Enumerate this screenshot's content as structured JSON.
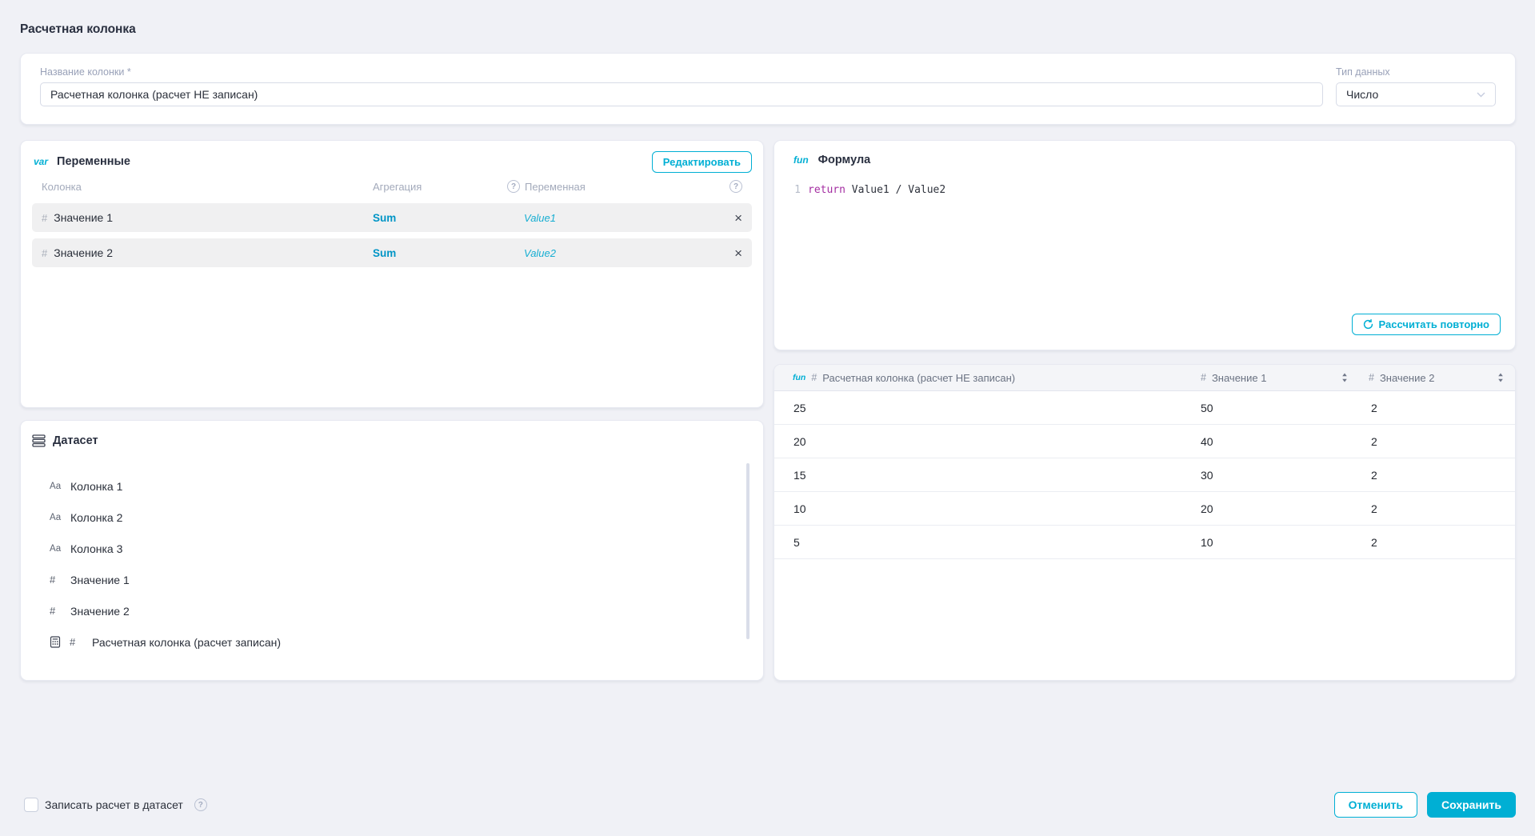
{
  "page": {
    "title": "Расчетная колонка"
  },
  "colors": {
    "accent": "#00afd4",
    "sum_accent": "#0095c6",
    "keyword": "#a42ea2",
    "background": "#f0f1f6"
  },
  "icons": {
    "help": "?",
    "close": "×",
    "text_type": "Аа",
    "number_type": "#"
  },
  "name_field": {
    "label": "Название колонки *",
    "value": "Расчетная колонка (расчет НЕ записан)"
  },
  "type_field": {
    "label": "Тип данных",
    "value": "Число"
  },
  "variables": {
    "tag": "var",
    "title": "Переменные",
    "edit_button": "Редактировать",
    "columns": {
      "column": "Колонка",
      "aggregation": "Агрегация",
      "variable": "Переменная"
    },
    "rows": [
      {
        "type_icon": "#",
        "column": "Значение 1",
        "aggregation": "Sum",
        "variable": "Value1"
      },
      {
        "type_icon": "#",
        "column": "Значение 2",
        "aggregation": "Sum",
        "variable": "Value2"
      }
    ]
  },
  "dataset": {
    "title": "Датасет",
    "items": [
      {
        "icon": "Аа",
        "label": "Колонка 1"
      },
      {
        "icon": "Аа",
        "label": "Колонка 2"
      },
      {
        "icon": "Аа",
        "label": "Колонка 3"
      },
      {
        "icon": "#",
        "label": "Значение 1"
      },
      {
        "icon": "#",
        "label": "Значение 2"
      },
      {
        "icon": "calculator",
        "hash": "#",
        "label": "Расчетная колонка (расчет записан)"
      }
    ]
  },
  "formula": {
    "tag": "fun",
    "title": "Формула",
    "line_number": "1",
    "keyword": "return",
    "expression": "Value1 / Value2",
    "recalc_button": "Рассчитать повторно"
  },
  "preview_table": {
    "columns": [
      {
        "tag": "fun",
        "type_icon": "#",
        "label": "Расчетная колонка (расчет НЕ записан)"
      },
      {
        "type_icon": "#",
        "label": "Значение 1"
      },
      {
        "type_icon": "#",
        "label": "Значение 2"
      }
    ],
    "rows": [
      [
        "25",
        "50",
        "2"
      ],
      [
        "20",
        "40",
        "2"
      ],
      [
        "15",
        "30",
        "2"
      ],
      [
        "10",
        "20",
        "2"
      ],
      [
        "5",
        "10",
        "2"
      ]
    ]
  },
  "footer": {
    "checkbox_label": "Записать расчет в датасет",
    "cancel_button": "Отменить",
    "save_button": "Сохранить"
  }
}
